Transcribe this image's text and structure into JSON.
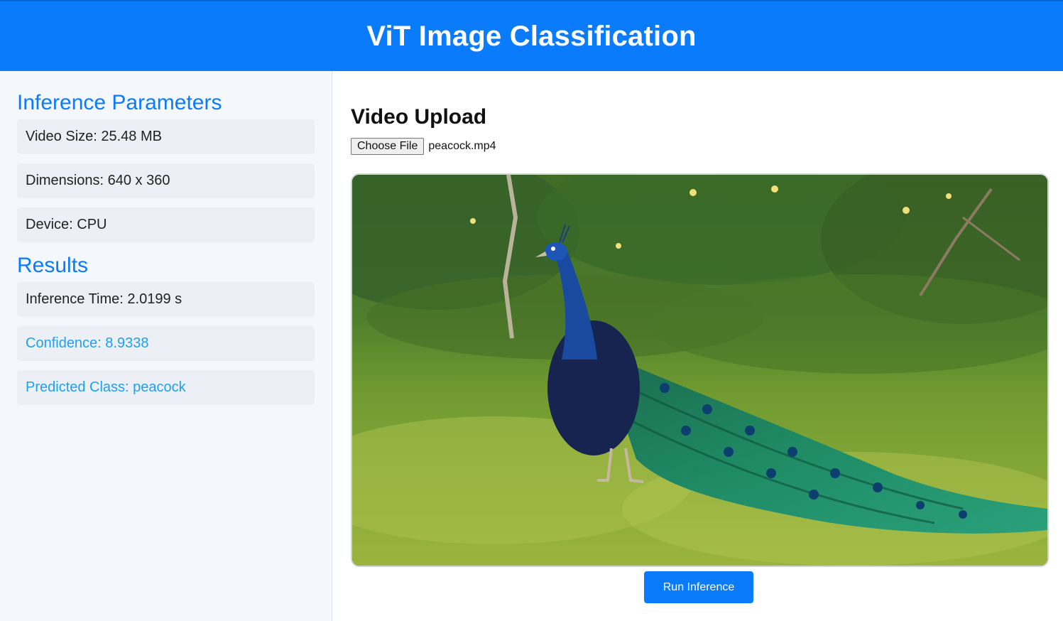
{
  "header": {
    "title": "ViT Image Classification"
  },
  "sidebar": {
    "params_title": "Inference Parameters",
    "params": [
      "Video Size: 25.48 MB",
      "Dimensions: 640 x 360",
      "Device: CPU"
    ],
    "results_title": "Results",
    "results": [
      "Inference Time: 2.0199 s",
      "Confidence: 8.9338",
      "Predicted Class: peacock"
    ]
  },
  "main": {
    "upload_title": "Video Upload",
    "choose_file_label": "Choose File",
    "file_name": "peacock.mp4",
    "video_subject": "peacock-on-grass",
    "run_button_label": "Run Inference"
  },
  "colors": {
    "accent": "#0a7bfb",
    "highlight_text": "#1ea0ef",
    "sidebar_bg": "#f4f7fb",
    "box_bg": "#ecf0f6"
  }
}
